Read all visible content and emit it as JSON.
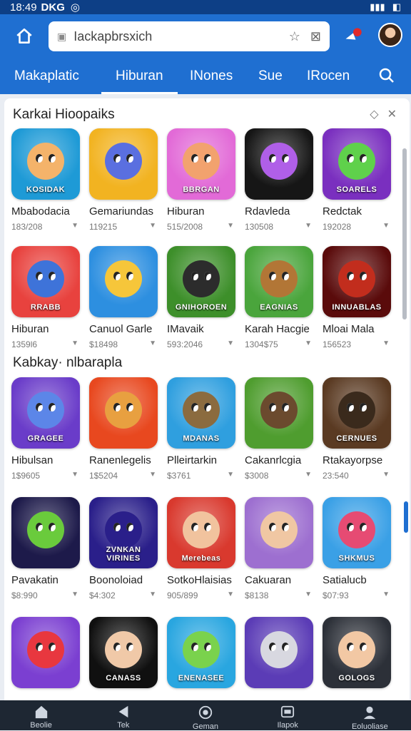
{
  "status": {
    "time": "18:49",
    "carrier": "DKG",
    "battery": "◧"
  },
  "search": {
    "placeholder": "Iackapbrsxich"
  },
  "tabs": [
    {
      "label": "Makaplatic"
    },
    {
      "label": "Hiburan"
    },
    {
      "label": "INones"
    },
    {
      "label": "Sue"
    },
    {
      "label": "IRocen"
    }
  ],
  "sections": [
    {
      "title": "Karkai Hioopaiks"
    },
    {
      "title": "Kabkay· nlbarapla"
    }
  ],
  "apps_row1": [
    {
      "name": "Mbabodacia",
      "meta": "183/208",
      "banner": "KOSIDAK",
      "bg": "#1e9ad6",
      "face": "#f4b36a"
    },
    {
      "name": "Gemariundas",
      "meta": "119215",
      "banner": "",
      "bg": "#f2b321",
      "face": "#5a6fe0"
    },
    {
      "name": "Hiburan",
      "meta": "515/2008",
      "banner": "BBRGAN",
      "bg": "#e26ad7",
      "face": "#f2a26e"
    },
    {
      "name": "Rdavleda",
      "meta": "130508",
      "banner": "",
      "bg": "#161616",
      "face": "#b05fe8"
    },
    {
      "name": "Redctak",
      "meta": "192028",
      "banner": "SOARELS",
      "bg": "#7a2fbf",
      "face": "#5fd14b"
    }
  ],
  "apps_row2": [
    {
      "name": "Hiburan",
      "meta": "1359l6",
      "banner": "RRABB",
      "bg": "#e8423e",
      "face": "#3e73d9"
    },
    {
      "name": "Canuol Garle",
      "meta": "$18498",
      "banner": "",
      "bg": "#2d8fe0",
      "face": "#f6c63a"
    },
    {
      "name": "IMavaik",
      "meta": "593:2046",
      "banner": "GNIHOROEN",
      "bg": "#3d8f2a",
      "face": "#2c2c2c"
    },
    {
      "name": "Karah Hacgie",
      "meta": "1304$75",
      "banner": "EAGNIAS",
      "bg": "#4aa53c",
      "face": "#b27636"
    },
    {
      "name": "Mloai Mala",
      "meta": "156523",
      "banner": "INNUABLAS",
      "bg": "#5a0b0b",
      "face": "#c22d1d"
    }
  ],
  "apps_row3": [
    {
      "name": "Hibulsan",
      "meta": "1$9605",
      "banner": "GRAGEE",
      "bg": "#6a3cc9",
      "face": "#5c86e8"
    },
    {
      "name": "Ranenlegelis",
      "meta": "1$5204",
      "banner": "",
      "bg": "#e8481f",
      "face": "#e8a040"
    },
    {
      "name": "Plleirtarkin",
      "meta": "$3761",
      "banner": "MDANAS",
      "bg": "#2f9fdf",
      "face": "#8b6b3f"
    },
    {
      "name": "Cakanrlcgia",
      "meta": "$3008",
      "banner": "",
      "bg": "#4f9d2f",
      "face": "#6b4a2e"
    },
    {
      "name": "Rtakayorpse",
      "meta": "23:540",
      "banner": "CERNUES",
      "bg": "#5a3a22",
      "face": "#3a2a1c"
    }
  ],
  "apps_row4": [
    {
      "name": "Pavakatin",
      "meta": "$8:990",
      "banner": "",
      "bg": "#1d1a4a",
      "face": "#6acb3c"
    },
    {
      "name": "Boonoloiad",
      "meta": "$4:302",
      "banner": "ZVNKAN VIRINES",
      "bg": "#2a1f8a",
      "face": "#2a1f8a"
    },
    {
      "name": "SotkoHlaisias",
      "meta": "905/899",
      "banner": "Merebeas",
      "bg": "#d9392e",
      "face": "#f1c39e"
    },
    {
      "name": "Cakuaran",
      "meta": "$8138",
      "banner": "",
      "bg": "#9d6fd0",
      "face": "#f0c7a3"
    },
    {
      "name": "Satialucb",
      "meta": "$07:93",
      "banner": "SHKMUS",
      "bg": "#3aa0e6",
      "face": "#e64b73"
    }
  ],
  "apps_row5": [
    {
      "name": "",
      "meta": "",
      "banner": "",
      "bg": "#7b3fd1",
      "face": "#e8373f"
    },
    {
      "name": "",
      "meta": "",
      "banner": "CANASS",
      "bg": "#101010",
      "face": "#f0c9a8"
    },
    {
      "name": "",
      "meta": "",
      "banner": "ENENASEE",
      "bg": "#29a6e0",
      "face": "#7ad24d"
    },
    {
      "name": "",
      "meta": "",
      "banner": "",
      "bg": "#5b3cb6",
      "face": "#d8d8e0"
    },
    {
      "name": "",
      "meta": "",
      "banner": "GOLOGS",
      "bg": "#2c3038",
      "face": "#f2c8a4"
    }
  ],
  "bottom_nav": [
    {
      "label": "Beolie"
    },
    {
      "label": "Tek"
    },
    {
      "label": "Geman"
    },
    {
      "label": "Ilapok"
    },
    {
      "label": "Eoluoliase"
    }
  ],
  "colors": {
    "accent": "#1f6fd1",
    "statusbar": "#0d3f86",
    "navbar": "#1e2733"
  }
}
